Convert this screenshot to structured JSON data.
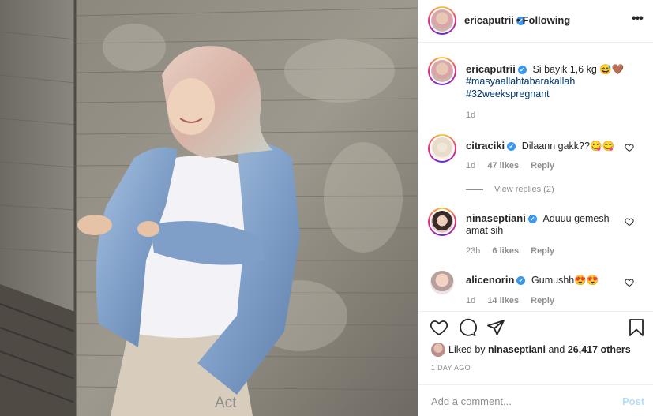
{
  "post": {
    "author": "ericaputrii",
    "follow_status": "Following",
    "more_label": "•••"
  },
  "caption": {
    "author": "ericaputrii",
    "text": "Si bayik 1,6 kg 😅🤎",
    "hashtags": [
      "#masyaallahtabarakallah",
      "#32weekspregnant"
    ],
    "age": "1d"
  },
  "comments": [
    {
      "user": "citraciki",
      "text": "Dilaann gakk??😋😋",
      "age": "1d",
      "likes": "47 likes",
      "reply": "Reply",
      "view_replies": "View replies (2)"
    },
    {
      "user": "ninaseptiani",
      "text_line1": "Aduuu gemesh",
      "text_line2": "amat sih",
      "age": "23h",
      "likes": "6 likes",
      "reply": "Reply"
    },
    {
      "user": "alicenorin",
      "text": "Gumushh😍😍",
      "age": "1d",
      "likes": "14 likes",
      "reply": "Reply"
    }
  ],
  "likes": {
    "prefix": "Liked by",
    "user": "ninaseptiani",
    "joiner": "and",
    "others": "26,417 others"
  },
  "time_ago": "1 DAY AGO",
  "composer": {
    "placeholder": "Add a comment...",
    "post_label": "Post"
  },
  "watermark": "Act",
  "icons": {
    "verified": "verified-badge-icon",
    "like": "heart-icon",
    "comment": "comment-icon",
    "share": "share-icon",
    "save": "bookmark-icon"
  },
  "colors": {
    "verified": "#3897f0",
    "hashtag": "#00376b",
    "muted": "#8e8e8e",
    "post_button": "#b2dffc"
  }
}
